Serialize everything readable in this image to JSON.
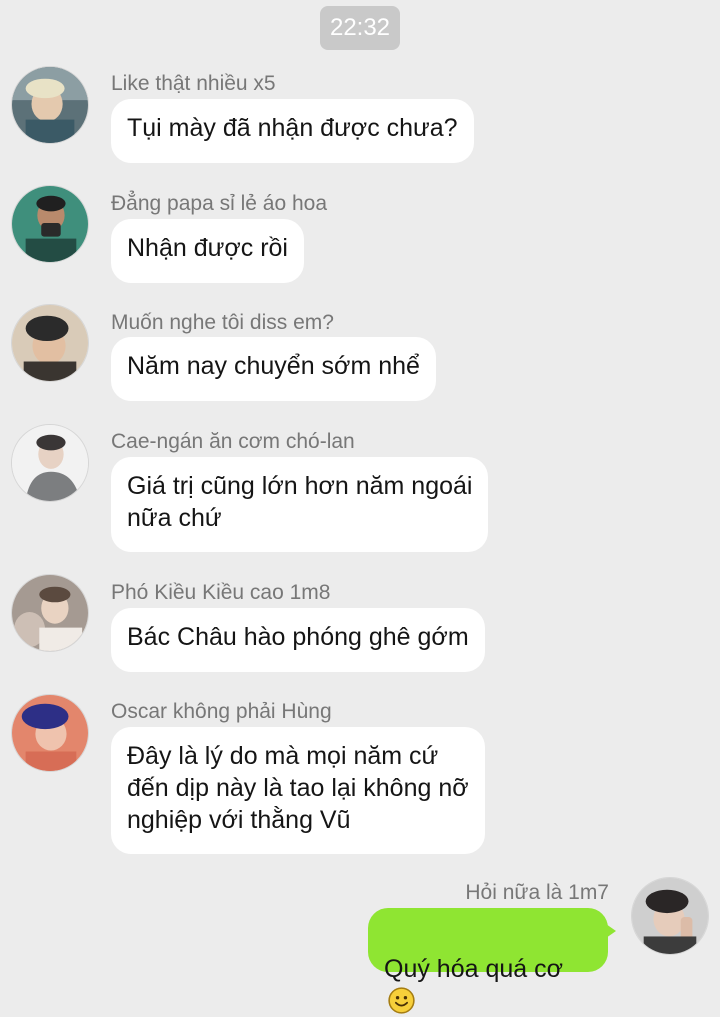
{
  "time": "22:32",
  "messages": [
    {
      "sender": "Like thật nhiều x5",
      "text": "Tụi mày đã nhận được chưa?"
    },
    {
      "sender": "Đẳng papa sỉ lẻ áo hoa",
      "text": "Nhận được rồi"
    },
    {
      "sender": "Muốn nghe tôi diss em?",
      "text": "Năm nay chuyển sớm nhể"
    },
    {
      "sender": "Cae-ngán ăn cơm chó-lan",
      "text": "Giá trị cũng lớn hơn năm ngoái\nnữa chứ"
    },
    {
      "sender": "Phó Kiều Kiều cao 1m8",
      "text": "Bác Châu hào phóng ghê gớm"
    },
    {
      "sender": "Oscar không phải Hùng",
      "text": "Đây là lý do mà mọi năm cứ\nđến dịp này là tao lại không nỡ\nnghiệp với thằng Vũ"
    }
  ],
  "own_message": {
    "sender": "Hỏi nữa là 1m7",
    "text": "Quý hóa quá cơ",
    "emoji_icon": "smiley-face-icon"
  },
  "colors": {
    "background": "#ececec",
    "incoming_bubble": "#ffffff",
    "outgoing_bubble": "#8fe532",
    "time_badge": "#c9c9c9"
  }
}
